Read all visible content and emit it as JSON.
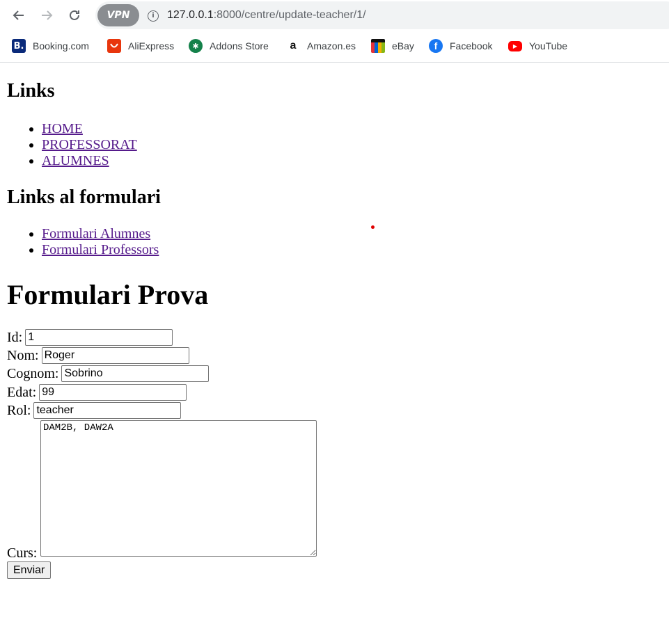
{
  "browser": {
    "url_host": "127.0.0.1",
    "url_path": ":8000/centre/update-teacher/1/",
    "vpn_label": "VPN",
    "bookmarks": [
      {
        "label": "Booking.com",
        "icon": "B."
      },
      {
        "label": "AliExpress",
        "icon": "⬛"
      },
      {
        "label": "Addons Store",
        "icon": "✱"
      },
      {
        "label": "Amazon.es",
        "icon": "a"
      },
      {
        "label": "eBay",
        "icon": ""
      },
      {
        "label": "Facebook",
        "icon": "f"
      },
      {
        "label": "YouTube",
        "icon": "▶"
      }
    ]
  },
  "page": {
    "links_heading": "Links",
    "links": [
      "HOME",
      "PROFESSORAT",
      "ALUMNES"
    ],
    "forms_heading": "Links al formulari",
    "form_links": [
      "Formulari Alumnes",
      "Formulari Professors"
    ],
    "form_title": "Formulari Prova",
    "fields": {
      "id": {
        "label": "Id:",
        "value": "1"
      },
      "nom": {
        "label": "Nom:",
        "value": "Roger"
      },
      "cognom": {
        "label": "Cognom:",
        "value": "Sobrino"
      },
      "edat": {
        "label": "Edat:",
        "value": "99"
      },
      "rol": {
        "label": "Rol:",
        "value": "teacher"
      },
      "curs": {
        "label": "Curs:",
        "value": "DAM2B, DAW2A"
      }
    },
    "submit_label": "Enviar"
  }
}
